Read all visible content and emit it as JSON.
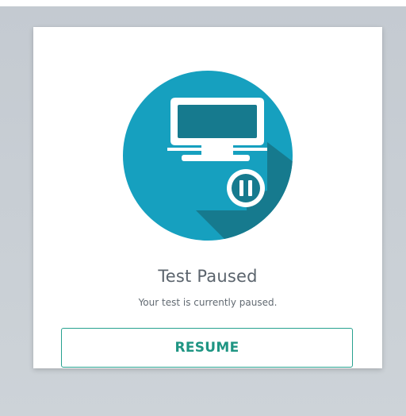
{
  "status": {
    "title": "Test Paused",
    "message": "Your test is currently paused.",
    "icon": "monitor-paused-icon"
  },
  "actions": {
    "resume_label": "RESUME"
  },
  "colors": {
    "icon_circle": "#16a0bf",
    "icon_shadow": "#167a8e",
    "button_text": "#1f9583",
    "button_border": "#27a18f",
    "title_text": "#5b646d"
  }
}
